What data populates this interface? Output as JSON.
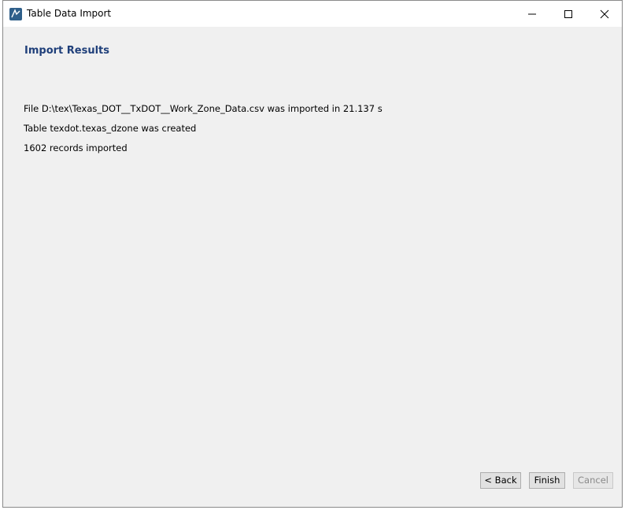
{
  "window": {
    "title": "Table Data Import",
    "icon": "mysql-workbench-icon"
  },
  "content": {
    "heading": "Import Results",
    "messages": [
      "File D:\\tex\\Texas_DOT__TxDOT__Work_Zone_Data.csv was imported in 21.137 s",
      "Table texdot.texas_dzone was created",
      "1602 records imported"
    ]
  },
  "buttons": {
    "back": "< Back",
    "finish": "Finish",
    "cancel": "Cancel"
  },
  "colors": {
    "heading": "#1f3f7a",
    "background": "#f0f0f0",
    "titlebar": "#ffffff"
  }
}
